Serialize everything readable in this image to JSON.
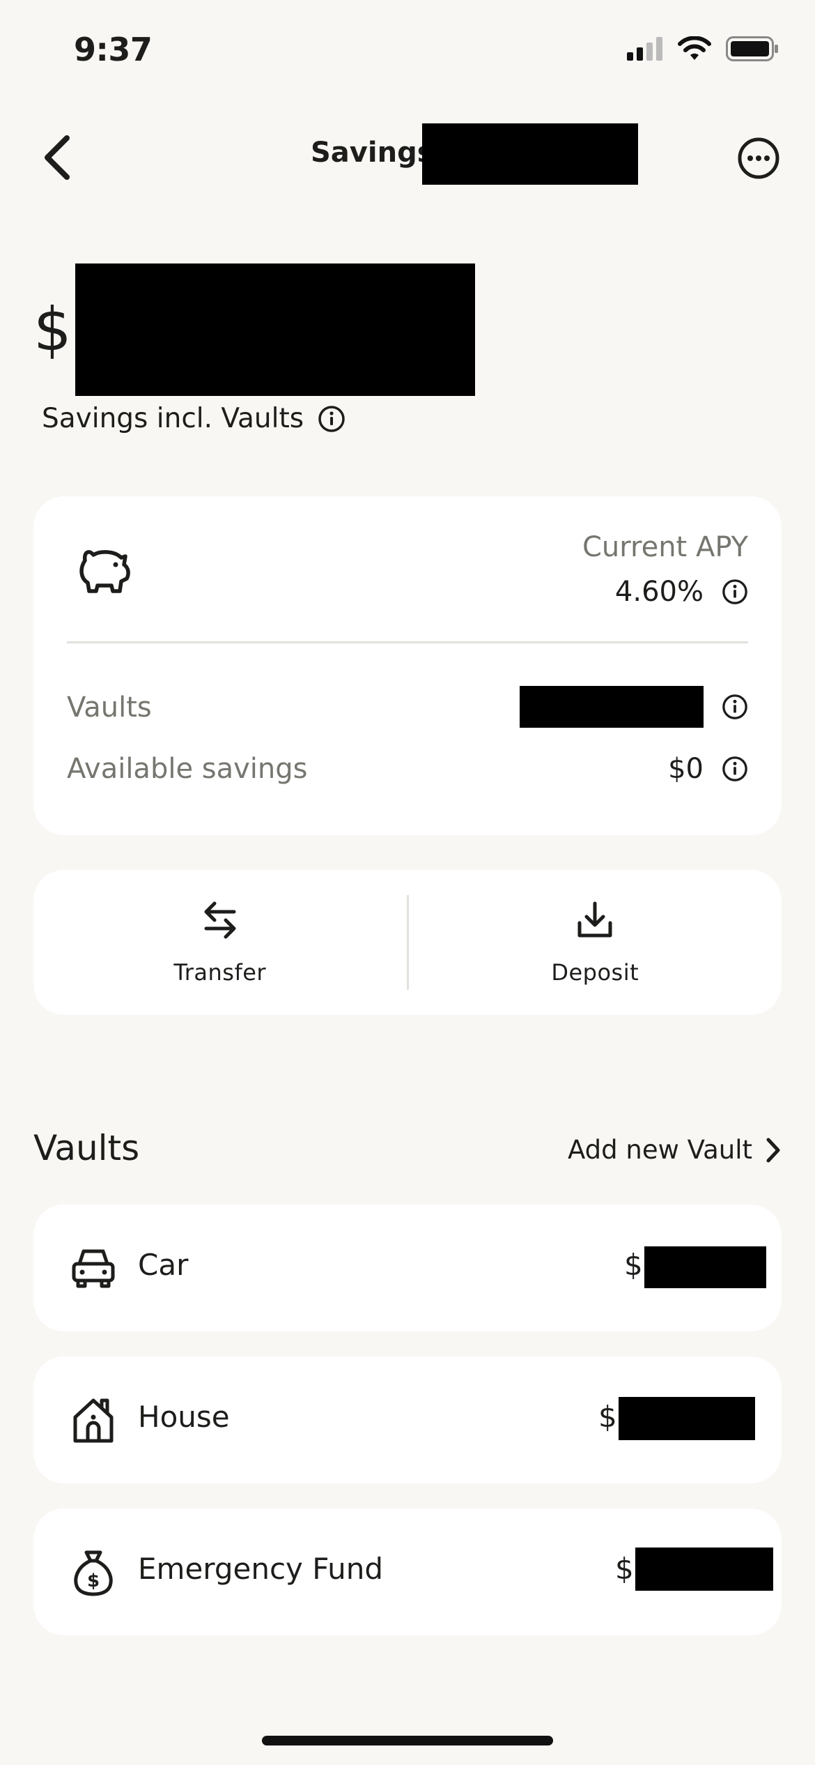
{
  "status_bar": {
    "time": "9:37"
  },
  "nav": {
    "title": "Savings"
  },
  "balance": {
    "currency": "$",
    "caption": "Savings incl. Vaults"
  },
  "summary": {
    "apy_label": "Current APY",
    "apy_value": "4.60%",
    "rows": [
      {
        "label": "Vaults",
        "value": ""
      },
      {
        "label": "Available savings",
        "value": "$0"
      }
    ]
  },
  "actions": [
    {
      "label": "Transfer",
      "icon": "transfer-arrows-icon"
    },
    {
      "label": "Deposit",
      "icon": "download-tray-icon"
    }
  ],
  "vaults": {
    "title": "Vaults",
    "add_label": "Add new Vault",
    "items": [
      {
        "name": "Car",
        "icon": "car-icon",
        "amount_prefix": "$"
      },
      {
        "name": "House",
        "icon": "house-icon",
        "amount_prefix": "$"
      },
      {
        "name": "Emergency Fund",
        "icon": "money-bag-icon",
        "amount_prefix": "$"
      }
    ]
  },
  "colors": {
    "background": "#f8f7f4",
    "card": "#ffffff",
    "muted_text": "#76756f",
    "text": "#1d1d1b"
  }
}
